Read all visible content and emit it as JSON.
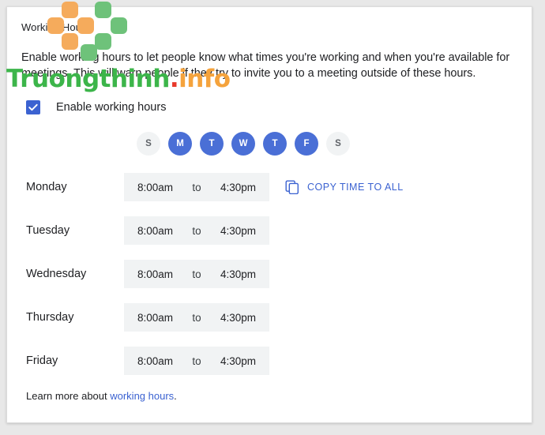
{
  "section": {
    "title": "Working Hours",
    "description": "Enable working hours to let people know what times you're working and when you're available for meetings. This will warn people if they try to invite you to a meeting outside of these hours."
  },
  "enable": {
    "label": "Enable working hours",
    "checked": true,
    "check_icon": "checkmark-icon"
  },
  "day_toggles": [
    {
      "letter": "S",
      "active": false,
      "day": "sunday"
    },
    {
      "letter": "M",
      "active": true,
      "day": "monday"
    },
    {
      "letter": "T",
      "active": true,
      "day": "tuesday"
    },
    {
      "letter": "W",
      "active": true,
      "day": "wednesday"
    },
    {
      "letter": "T",
      "active": true,
      "day": "thursday"
    },
    {
      "letter": "F",
      "active": true,
      "day": "friday"
    },
    {
      "letter": "S",
      "active": false,
      "day": "saturday"
    }
  ],
  "time_separator": "to",
  "rows": [
    {
      "day": "Monday",
      "start": "8:00am",
      "end": "4:30pm",
      "has_copy_action": true
    },
    {
      "day": "Tuesday",
      "start": "8:00am",
      "end": "4:30pm",
      "has_copy_action": false
    },
    {
      "day": "Wednesday",
      "start": "8:00am",
      "end": "4:30pm",
      "has_copy_action": false
    },
    {
      "day": "Thursday",
      "start": "8:00am",
      "end": "4:30pm",
      "has_copy_action": false
    },
    {
      "day": "Friday",
      "start": "8:00am",
      "end": "4:30pm",
      "has_copy_action": false
    }
  ],
  "copy_action": {
    "label": "COPY TIME TO ALL",
    "icon": "copy-icon"
  },
  "footer": {
    "text_before": "Learn more about ",
    "link_text": "working hours",
    "text_after": "."
  },
  "watermark": {
    "text_part1": "Truongthinh",
    "text_dot": ".",
    "text_part2": "info",
    "color_green": "#3cb54a",
    "color_red": "#e8392b",
    "color_orange": "#f5a33c",
    "block_orange": "#f5ab5c",
    "block_green": "#6ec27a"
  },
  "colors": {
    "accent_blue": "#3b62d1",
    "toggle_blue": "#4a6fd6",
    "field_gray": "#f1f3f4",
    "text_primary": "#202124"
  }
}
